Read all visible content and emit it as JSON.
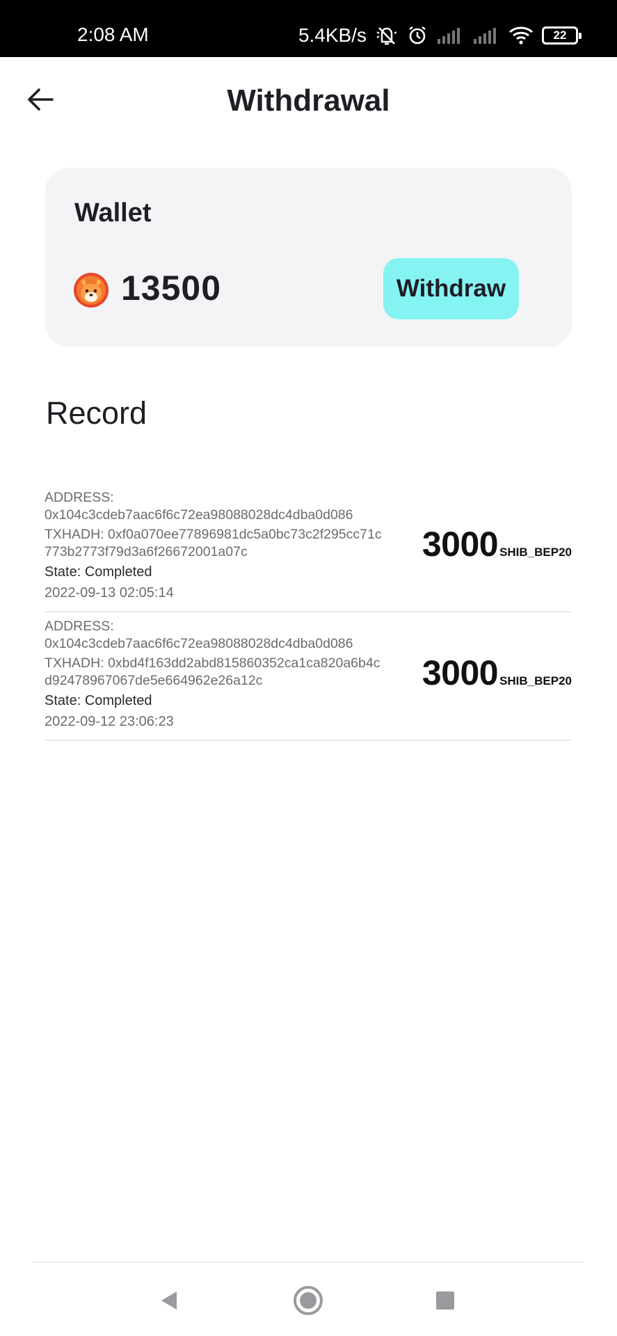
{
  "status_bar": {
    "time": "2:08 AM",
    "network_speed": "5.4KB/s",
    "battery_level": "22",
    "icons": [
      "mute-icon",
      "alarm-icon",
      "signal-icon",
      "signal-icon",
      "wifi-icon",
      "battery-icon"
    ]
  },
  "header": {
    "title": "Withdrawal",
    "back_icon": "arrow-left-icon"
  },
  "wallet": {
    "label": "Wallet",
    "coin_icon": "shiba-inu-coin-icon",
    "balance": "13500",
    "withdraw_label": "Withdraw",
    "button_color": "#86f3f3"
  },
  "records": {
    "title": "Record",
    "items": [
      {
        "address_label": "ADDRESS:",
        "address": "0x104c3cdeb7aac6f6c72ea98088028dc4dba0d086",
        "txhash_line1": "TXHADH: 0xf0a070ee77896981dc5a0bc73c2f295cc71c",
        "txhash_line2": "773b2773f79d3a6f26672001a07c",
        "state": "State: Completed",
        "date": "2022-09-13 02:05:14",
        "amount": "3000",
        "unit": "SHIB_BEP20"
      },
      {
        "address_label": "ADDRESS:",
        "address": "0x104c3cdeb7aac6f6c72ea98088028dc4dba0d086",
        "txhash_line1": "TXHADH: 0xbd4f163dd2abd815860352ca1ca820a6b4c",
        "txhash_line2": "d92478967067de5e664962e26a12c",
        "state": "State: Completed",
        "date": "2022-09-12 23:06:23",
        "amount": "3000",
        "unit": "SHIB_BEP20"
      }
    ]
  },
  "nav_bar": {
    "icons": [
      "back-triangle-icon",
      "home-circle-icon",
      "recents-square-icon"
    ]
  }
}
